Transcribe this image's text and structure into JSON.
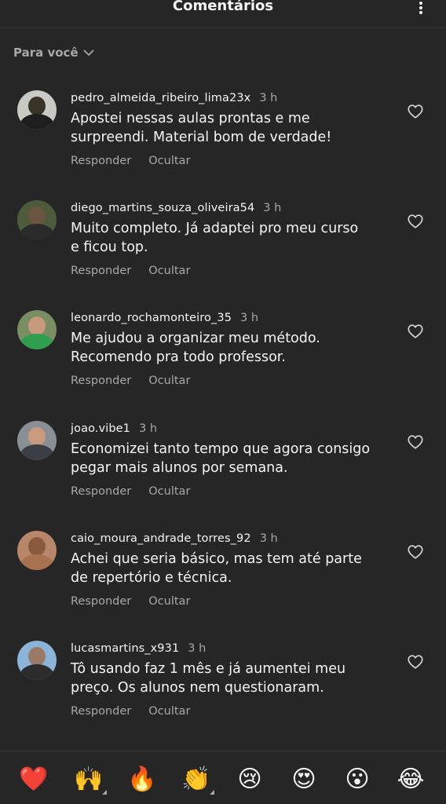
{
  "header": {
    "title": "Comentários",
    "more_icon": "more-vertical-icon"
  },
  "filter": {
    "label": "Para você",
    "icon": "chevron-down-icon"
  },
  "comments": [
    {
      "username": "pedro_almeida_ribeiro_lima23x",
      "time": "3 h",
      "line1": "Apostei nessas aulas prontas e me",
      "line2": "surpreendi. Material bom de verdade!",
      "reply": "Responder",
      "hide": "Ocultar",
      "avatar": {
        "bg": "#c9c9c6",
        "head": "#3a3329",
        "body": "#1e1e1e"
      }
    },
    {
      "username": "diego_martins_souza_oliveira54",
      "time": "3 h",
      "line1": "Muito completo. Já adaptei pro meu curso",
      "line2": "e ficou top.",
      "reply": "Responder",
      "hide": "Ocultar",
      "avatar": {
        "bg": "#4d5a3c",
        "head": "#6b5440",
        "body": "#2a2a2a"
      }
    },
    {
      "username": "leonardo_rochamonteiro_35",
      "time": "3 h",
      "line1": "Me ajudou a organizar meu método.",
      "line2": "Recomendo pra todo professor.",
      "reply": "Responder",
      "hide": "Ocultar",
      "avatar": {
        "bg": "#7a8d63",
        "head": "#c79a80",
        "body": "#2f9e4f"
      }
    },
    {
      "username": "joao.vibe1",
      "time": "3 h",
      "line1": "Economizei tanto tempo que agora consigo",
      "line2": "pegar mais alunos por semana.",
      "reply": "Responder",
      "hide": "Ocultar",
      "avatar": {
        "bg": "#8a8f94",
        "head": "#c99a7e",
        "body": "#3b3f45"
      }
    },
    {
      "username": "caio_moura_andrade_torres_92",
      "time": "3 h",
      "line1": "Achei que seria básico, mas tem até parte",
      "line2": "de repertório e técnica.",
      "reply": "Responder",
      "hide": "Ocultar",
      "avatar": {
        "bg": "#b8866a",
        "head": "#8a5a3e",
        "body": "#a8714f"
      }
    },
    {
      "username": "lucasmartins_x931",
      "time": "3 h",
      "line1": "Tô usando faz 1 mês e já aumentei meu",
      "line2": "preço. Os alunos nem questionaram.",
      "reply": "Responder",
      "hide": "Ocultar",
      "avatar": {
        "bg": "#8ab4d8",
        "head": "#9a7a66",
        "body": "#2c2c2c"
      }
    }
  ],
  "reactions": [
    {
      "name": "red-heart",
      "glyph": "❤️",
      "has_options": false
    },
    {
      "name": "raising-hands",
      "glyph": "🙌",
      "has_options": true
    },
    {
      "name": "fire",
      "glyph": "🔥",
      "has_options": false
    },
    {
      "name": "clapping-hands",
      "glyph": "👏",
      "has_options": true
    },
    {
      "name": "crying-face",
      "glyph": "😢",
      "has_options": false
    },
    {
      "name": "heart-eyes",
      "glyph": "😍",
      "has_options": false
    },
    {
      "name": "surprised-face",
      "glyph": "😮",
      "has_options": false
    },
    {
      "name": "tears-of-joy",
      "glyph": "😂",
      "has_options": false
    }
  ],
  "colors": {
    "background": "#262626",
    "text": "#f5f5f5",
    "muted": "#a8a8a8",
    "divider": "#363636"
  }
}
